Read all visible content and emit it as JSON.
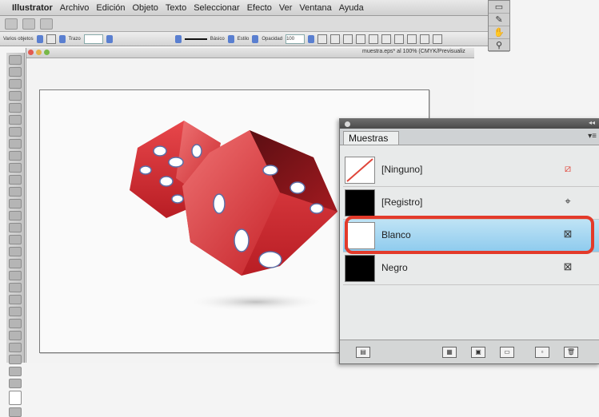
{
  "menubar": {
    "apple_glyph": "",
    "app_name": "Illustrator",
    "items": [
      "Archivo",
      "Edición",
      "Objeto",
      "Texto",
      "Seleccionar",
      "Efecto",
      "Ver",
      "Ventana",
      "Ayuda"
    ]
  },
  "control_bar": {
    "selection_label": "Varios objetos",
    "stroke_label": "Trazo",
    "brush_label": "Básico",
    "style_label": "Estilo",
    "opacity_label": "Opacidad",
    "opacity_value": "100"
  },
  "document": {
    "title": "muestra.eps* al 100% (CMYK/Previsualiz"
  },
  "swatches_panel": {
    "tab_label": "Muestras",
    "menu_icon": "panel-menu-icon",
    "rows": [
      {
        "name": "[Ninguno]",
        "icon_glyph": "⧄",
        "icon": "none-icon"
      },
      {
        "name": "[Registro]",
        "icon_glyph": "⌖",
        "icon": "registration-icon"
      },
      {
        "name": "Blanco",
        "icon_glyph": "⊠",
        "icon": "process-color-icon"
      },
      {
        "name": "Negro",
        "icon_glyph": "⊠",
        "icon": "process-color-icon"
      }
    ],
    "colors": {
      "selected_row": "#9fd4f0",
      "highlight_ring": "#e33a2a",
      "black_swatch": "#000000",
      "none_slash": "#e0463a"
    }
  },
  "canvas": {
    "art_description_colors": {
      "dice_red": "#d62f33",
      "pips": "#ffffff"
    }
  }
}
